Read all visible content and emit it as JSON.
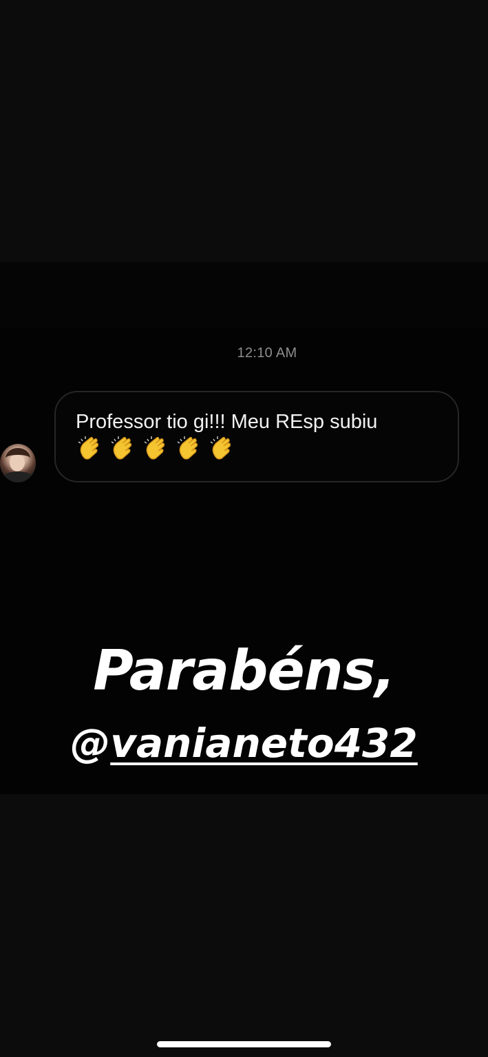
{
  "message": {
    "timestamp": "12:10 AM",
    "text": "Professor tio gi!!! Meu REsp subiu",
    "emoji": [
      "clapping-hands",
      "clapping-hands",
      "clapping-hands",
      "clapping-hands",
      "clapping-hands"
    ],
    "emoji_color": "#f4c531"
  },
  "story": {
    "title": "Parabéns,",
    "mention_prefix": "@",
    "mention_handle": "vanianeto432"
  },
  "colors": {
    "background": "#0b0b0b",
    "story_background": "#030303",
    "bubble_border": "#262626",
    "timestamp": "#8e8e8e",
    "text": "#ffffff"
  }
}
